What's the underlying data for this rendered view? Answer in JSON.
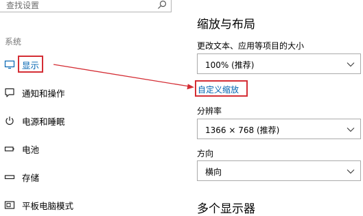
{
  "search": {
    "placeholder": "查找设置"
  },
  "sidebar": {
    "section_label": "系统",
    "items": [
      {
        "label": "显示",
        "icon": "monitor-icon"
      },
      {
        "label": "通知和操作",
        "icon": "notification-icon"
      },
      {
        "label": "电源和睡眠",
        "icon": "power-icon"
      },
      {
        "label": "电池",
        "icon": "battery-icon"
      },
      {
        "label": "存储",
        "icon": "storage-icon"
      },
      {
        "label": "平板电脑模式",
        "icon": "tablet-mode-icon"
      }
    ]
  },
  "main": {
    "heading": "缩放与布局",
    "scale_label": "更改文本、应用等项目的大小",
    "scale_value": "100% (推荐)",
    "custom_scale_link": "自定义缩放",
    "resolution_label": "分辨率",
    "resolution_value": "1366 × 768 (推荐)",
    "orientation_label": "方向",
    "orientation_value": "横向",
    "multi_display_heading": "多个显示器"
  },
  "colors": {
    "accent": "#0063b1",
    "annotation_red": "#d42d34",
    "secondary_text": "#767676"
  }
}
